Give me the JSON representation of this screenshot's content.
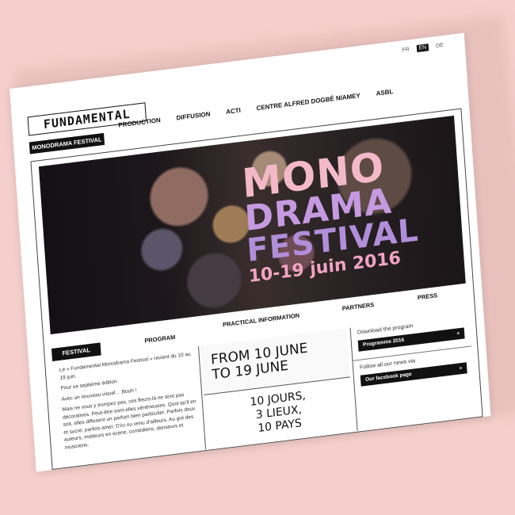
{
  "lang": [
    "FR",
    "EN",
    "DE"
  ],
  "lang_active": "EN",
  "logo": "FUNDAMENTAL",
  "nav": [
    "PRODUCTION",
    "DIFFUSION",
    "ACTI",
    "CENTRE ALFRED DOGBÉ NIAMEY",
    "ASBL"
  ],
  "badge": "MONODRAMA FESTIVAL",
  "hero": {
    "line1": "MONO",
    "line2": "DRAMA",
    "line3": "FESTIVAL",
    "line4": "10-19 juin 2016"
  },
  "subnav": {
    "festival": "FESTIVAL",
    "program": "PROGRAM",
    "practical": "PRACTICAL INFORMATION",
    "partners": "PARTNERS",
    "press": "PRESS"
  },
  "intro": {
    "p1": "Le « Fundamental Monodrama Festival » revient du 10 au 19 juin.",
    "p2": "Pour sa septième édition.",
    "p3": "Avec un nouveau visuel… Bouh !",
    "p4": "Mais ne vous y trompez pas, ces fleurs-là ne sont pas décoratives. Peut-être sont-elles vénéneuses. Quoi qu'il en soit, elles diffusent un parfum bien particulier. Parfois doux et sucré, parfois amer. D'ici ou venu d'ailleurs. Au gré des auteurs, metteurs en scène, comédiens, danseurs et musiciens."
  },
  "dates": {
    "line1": "FROM 10 JUNE",
    "line2": "TO 19 JUNE"
  },
  "counts": {
    "line1": "10 JOURS,",
    "line2": "3 LIEUX,",
    "line3": "10 PAYS"
  },
  "side": {
    "download_label": "Download the program",
    "download_button": "Programme 2016",
    "follow_label": "Follow all our news via",
    "follow_button": "Our facebook page",
    "arrow": "»"
  }
}
